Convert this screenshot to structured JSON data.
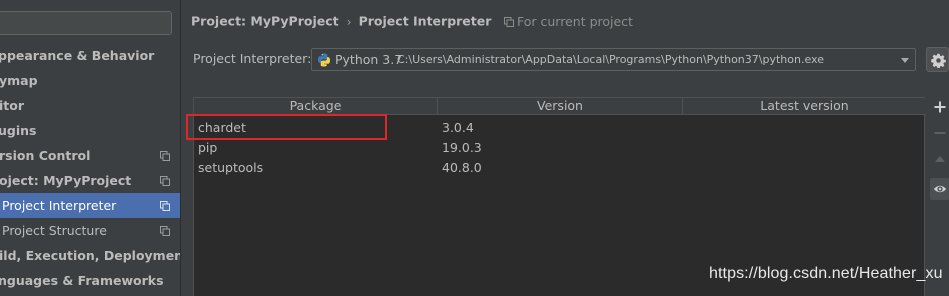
{
  "sidebar": {
    "items": [
      {
        "label": "ppearance & Behavior",
        "bold": true
      },
      {
        "label": "ymap",
        "bold": true
      },
      {
        "label": "itor",
        "bold": true
      },
      {
        "label": "ugins",
        "bold": true
      },
      {
        "label": "rsion Control",
        "bold": true
      },
      {
        "label": "oject: MyPyProject",
        "bold": true
      },
      {
        "label": "Project Interpreter",
        "bold": false
      },
      {
        "label": "Project Structure",
        "bold": false
      },
      {
        "label": "ild, Execution, Deployment",
        "bold": true
      },
      {
        "label": "nguages & Frameworks",
        "bold": true
      }
    ]
  },
  "header": {
    "breadcrumb_project": "Project: MyPyProject",
    "breadcrumb_page": "Project Interpreter",
    "for_current_project": "For current project"
  },
  "interpreter": {
    "label": "Project Interpreter:",
    "name": "Python 3.7",
    "path": "C:\\Users\\Administrator\\AppData\\Local\\Programs\\Python\\Python37\\python.exe"
  },
  "packages": {
    "columns": [
      "Package",
      "Version",
      "Latest version"
    ],
    "rows": [
      {
        "package": "chardet",
        "version": "3.0.4",
        "latest": ""
      },
      {
        "package": "pip",
        "version": "19.0.3",
        "latest": ""
      },
      {
        "package": "setuptools",
        "version": "40.8.0",
        "latest": ""
      }
    ]
  },
  "toolbar": {
    "add_icon": "plus-icon",
    "remove_icon": "minus-icon",
    "upgrade_icon": "upgrade-icon",
    "show_early_releases_icon": "eye-icon"
  },
  "watermark": "https://blog.csdn.net/Heather_xu",
  "colors": {
    "selection": "#4b6eaf",
    "highlight_box": "#e0252b",
    "panel": "#3c3f41",
    "table_bg": "#2b2b2b"
  }
}
